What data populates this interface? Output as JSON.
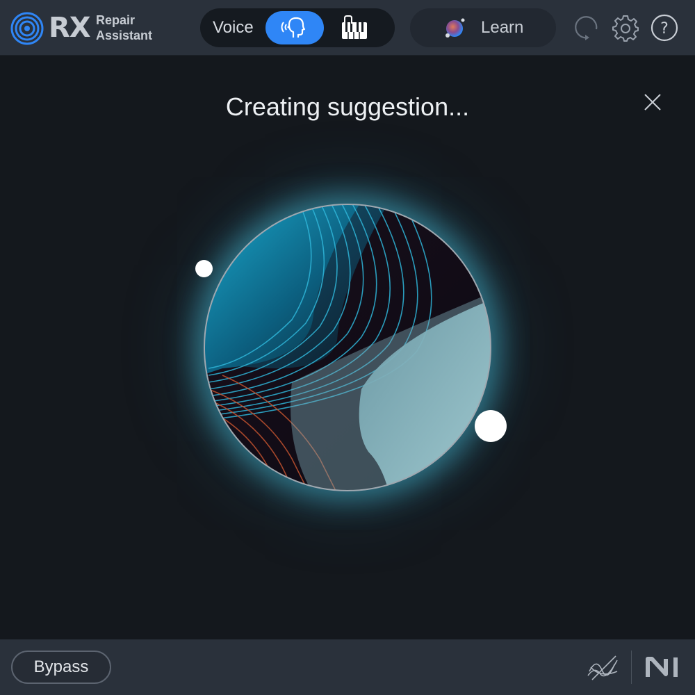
{
  "header": {
    "logo": {
      "mark": "RX",
      "sub_line1": "Repair",
      "sub_line2": "Assistant",
      "icon": "rx-rings-icon"
    },
    "mode_switch": {
      "voice_label": "Voice",
      "selected": "voice",
      "voice_icon": "speaking-head-icon",
      "music_icon": "instrument-keys-icon"
    },
    "learn": {
      "label": "Learn",
      "icon": "learn-orb-icon"
    },
    "icons": [
      "redo-icon",
      "gear-icon",
      "help-icon"
    ]
  },
  "main": {
    "title": "Creating suggestion...",
    "close_icon": "close-icon"
  },
  "footer": {
    "bypass_label": "Bypass",
    "logos": [
      "izotope-logo",
      "native-instruments-logo"
    ]
  },
  "colors": {
    "header_bg": "#2a313b",
    "main_bg": "#14181d",
    "accent": "#2f86f6",
    "orb_glow": "#46b4cd"
  }
}
